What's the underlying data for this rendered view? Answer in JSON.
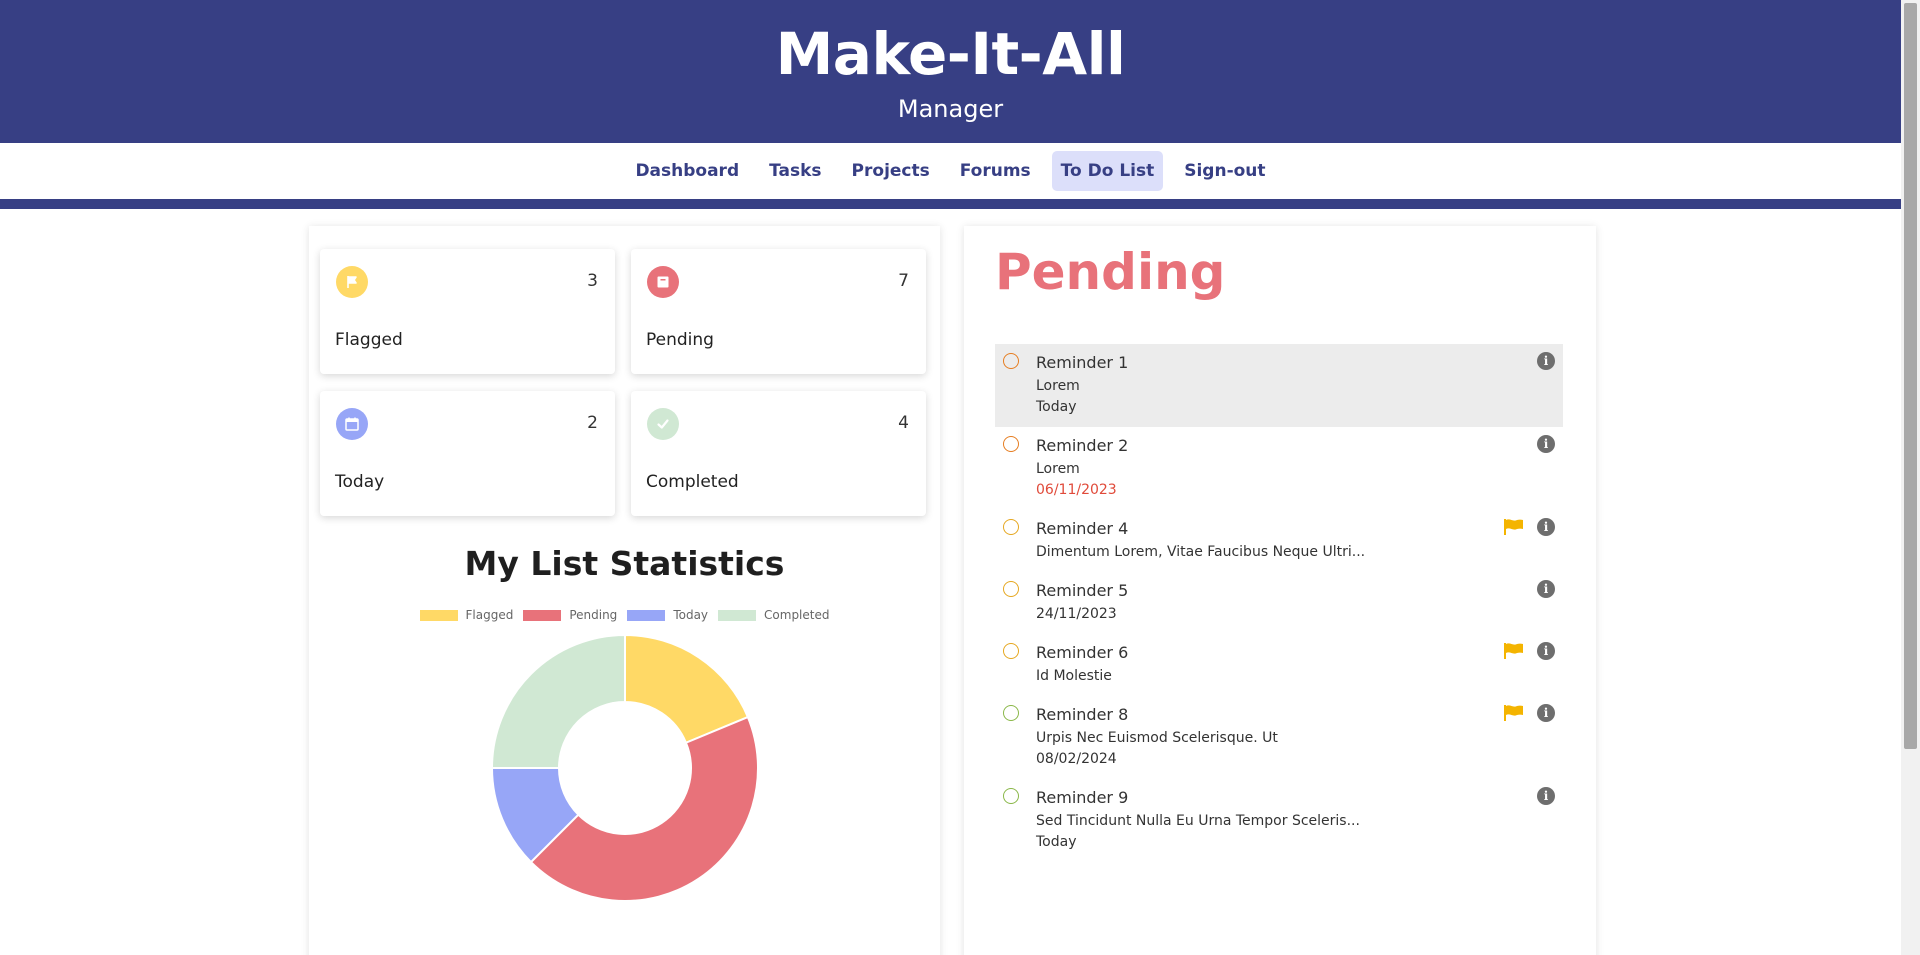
{
  "header": {
    "title": "Make-It-All",
    "role": "Manager"
  },
  "nav": [
    {
      "label": "Dashboard",
      "active": false
    },
    {
      "label": "Tasks",
      "active": false
    },
    {
      "label": "Projects",
      "active": false
    },
    {
      "label": "Forums",
      "active": false
    },
    {
      "label": "To Do List",
      "active": true
    },
    {
      "label": "Sign-out",
      "active": false
    }
  ],
  "stats": [
    {
      "label": "Flagged",
      "count": "3",
      "icon": "flag-icon",
      "color": "#ffd966"
    },
    {
      "label": "Pending",
      "count": "7",
      "icon": "box-icon",
      "color": "#e8727a"
    },
    {
      "label": "Today",
      "count": "2",
      "icon": "calendar-icon",
      "color": "#97a6f7"
    },
    {
      "label": "Completed",
      "count": "4",
      "icon": "check-icon",
      "color": "#d0e8d3"
    }
  ],
  "chart_title": "My List Statistics",
  "chart_data": {
    "type": "pie",
    "categories": [
      "Flagged",
      "Pending",
      "Today",
      "Completed"
    ],
    "values": [
      3,
      7,
      2,
      4
    ],
    "colors": [
      "#ffd966",
      "#e8727a",
      "#97a6f7",
      "#d0e8d3"
    ],
    "legend": "top"
  },
  "pending": {
    "title": "Pending",
    "reminders": [
      {
        "title": "Reminder 1",
        "line2": "Lorem",
        "line3": "Today",
        "line3_color": "#333333",
        "flagged": false,
        "selected": true,
        "circle_color": "#e67e22"
      },
      {
        "title": "Reminder 2",
        "line2": "Lorem",
        "line3": "06/11/2023",
        "line3_color": "#e04a3a",
        "flagged": false,
        "selected": false,
        "circle_color": "#e67e22"
      },
      {
        "title": "Reminder 4",
        "line2": "Dimentum Lorem, Vitae Faucibus Neque Ultri...",
        "line3": "",
        "line3_color": "#333333",
        "flagged": true,
        "selected": false,
        "circle_color": "#e6a822"
      },
      {
        "title": "Reminder 5",
        "line2": "24/11/2023",
        "line3": "",
        "line3_color": "#333333",
        "flagged": false,
        "selected": false,
        "circle_color": "#e6a822"
      },
      {
        "title": "Reminder 6",
        "line2": "Id Molestie",
        "line3": "",
        "line3_color": "#333333",
        "flagged": true,
        "selected": false,
        "circle_color": "#e6a822"
      },
      {
        "title": "Reminder 8",
        "line2": "Urpis Nec Euismod Scelerisque. Ut",
        "line3": "08/02/2024",
        "line3_color": "#333333",
        "flagged": true,
        "selected": false,
        "circle_color": "#8bb84a"
      },
      {
        "title": "Reminder 9",
        "line2": "Sed Tincidunt Nulla Eu Urna Tempor Sceleris...",
        "line3": "Today",
        "line3_color": "#333333",
        "flagged": false,
        "selected": false,
        "circle_color": "#8bb84a"
      }
    ]
  }
}
